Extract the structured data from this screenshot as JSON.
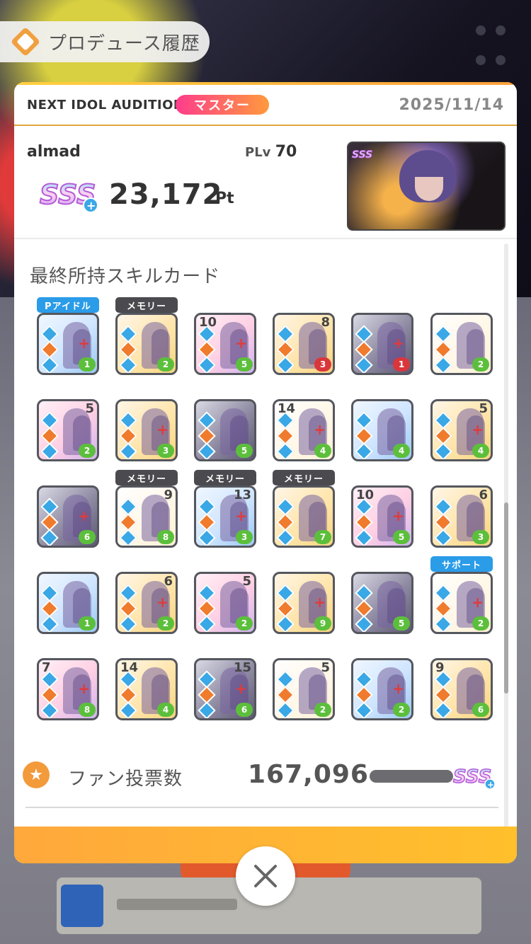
{
  "header": {
    "title": "プロデュース履歴"
  },
  "audition": {
    "name": "NEXT IDOL AUDITION",
    "rank_label": "マスター",
    "date": "2025/11/14"
  },
  "player": {
    "name": "almad",
    "plv_label": "PLv",
    "plv_value": "70",
    "grade": "SSS+",
    "score": "23,172",
    "score_unit": "Pt"
  },
  "skill_cards": {
    "title": "最終所持スキルカード",
    "tags": {
      "idol": "Pアイドル",
      "memory": "メモリー",
      "support": "サポート"
    },
    "rows": [
      [
        {
          "tag": "idol",
          "num": "",
          "cost": "1"
        },
        {
          "tag": "memory",
          "num": "",
          "cost": "2"
        },
        {
          "num_left": "10",
          "cost": "5"
        },
        {
          "num": "8",
          "cost": "3",
          "cost_color": "red"
        },
        {
          "cost": "1",
          "cost_color": "red"
        },
        {
          "cost": "2"
        }
      ],
      [
        {
          "num": "5",
          "cost": "2"
        },
        {
          "cost": "3"
        },
        {
          "cost": "5"
        },
        {
          "num_left": "14",
          "cost": "4"
        },
        {
          "cost": "4"
        },
        {
          "num": "5",
          "cost": "4"
        }
      ],
      [
        {
          "cost": "6"
        },
        {
          "tag": "memory",
          "num": "9",
          "cost": "8"
        },
        {
          "tag": "memory",
          "num": "13",
          "cost": "3"
        },
        {
          "tag": "memory",
          "cost": "7"
        },
        {
          "num_left": "10",
          "cost": "5"
        },
        {
          "num": "6",
          "cost": "3"
        }
      ],
      [
        {
          "cost": "1"
        },
        {
          "num": "6",
          "cost": "2"
        },
        {
          "num": "5",
          "cost": "2"
        },
        {
          "cost": "9"
        },
        {
          "cost": "5"
        },
        {
          "tag": "support",
          "cost": "2"
        }
      ],
      [
        {
          "num_left": "7",
          "cost": "8"
        },
        {
          "num_left": "14",
          "cost": "4"
        },
        {
          "num": "15",
          "cost": "6"
        },
        {
          "num": "5",
          "cost": "2"
        },
        {
          "cost": "2"
        },
        {
          "num_left": "9",
          "cost": "6"
        }
      ]
    ]
  },
  "fan_votes": {
    "label": "ファン投票数",
    "value": "167,096",
    "grade": "SSS+"
  },
  "close_button": {
    "icon": "close-icon"
  },
  "colors": {
    "accent_orange": "#ffa83c",
    "rank_pink": "#ff3c8c",
    "tag_blue": "#2a9ce8"
  }
}
